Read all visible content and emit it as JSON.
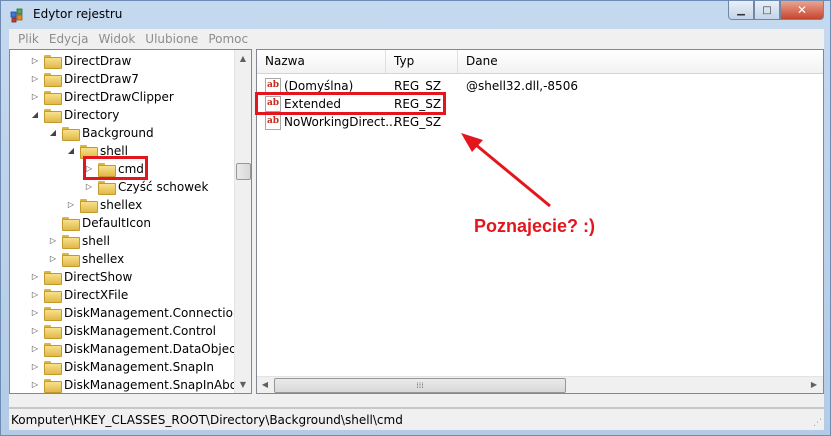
{
  "window": {
    "title": "Edytor rejestru",
    "minimize": "▁",
    "maximize": "□",
    "close": "✕"
  },
  "menu": {
    "items": [
      "Plik",
      "Edycja",
      "Widok",
      "Ulubione",
      "Pomoc"
    ]
  },
  "tree": {
    "items": [
      {
        "label": "DirectDraw",
        "depth": 1,
        "expander": "▷"
      },
      {
        "label": "DirectDraw7",
        "depth": 1,
        "expander": "▷"
      },
      {
        "label": "DirectDrawClipper",
        "depth": 1,
        "expander": "▷"
      },
      {
        "label": "Directory",
        "depth": 1,
        "expander": "◢"
      },
      {
        "label": "Background",
        "depth": 2,
        "expander": "◢"
      },
      {
        "label": "shell",
        "depth": 3,
        "expander": "◢"
      },
      {
        "label": "cmd",
        "depth": 4,
        "expander": "▷",
        "selected": true
      },
      {
        "label": "Czyść schowek",
        "depth": 4,
        "expander": "▷"
      },
      {
        "label": "shellex",
        "depth": 3,
        "expander": "▷"
      },
      {
        "label": "DefaultIcon",
        "depth": 2,
        "expander": ""
      },
      {
        "label": "shell",
        "depth": 2,
        "expander": "▷"
      },
      {
        "label": "shellex",
        "depth": 2,
        "expander": "▷"
      },
      {
        "label": "DirectShow",
        "depth": 1,
        "expander": "▷"
      },
      {
        "label": "DirectXFile",
        "depth": 1,
        "expander": "▷"
      },
      {
        "label": "DiskManagement.Connection",
        "depth": 1,
        "expander": "▷"
      },
      {
        "label": "DiskManagement.Control",
        "depth": 1,
        "expander": "▷"
      },
      {
        "label": "DiskManagement.DataObject",
        "depth": 1,
        "expander": "▷"
      },
      {
        "label": "DiskManagement.SnapIn",
        "depth": 1,
        "expander": "▷"
      },
      {
        "label": "DiskManagement.SnapInAbout",
        "depth": 1,
        "expander": "▷"
      }
    ]
  },
  "list": {
    "columns": [
      "Nazwa",
      "Typ",
      "Dane"
    ],
    "rows": [
      {
        "name": "(Domyślna)",
        "type": "REG_SZ",
        "data": "@shell32.dll,-8506",
        "icon": "ab"
      },
      {
        "name": "Extended",
        "type": "REG_SZ",
        "data": "",
        "icon": "ab"
      },
      {
        "name": "NoWorkingDirect...",
        "type": "REG_SZ",
        "data": "",
        "icon": "ab"
      }
    ]
  },
  "scroll": {
    "up": "▲",
    "down": "▼",
    "left": "◀",
    "right": "▶",
    "grip": "⁞⁞⁞"
  },
  "status": {
    "path": "Komputer\\HKEY_CLASSES_ROOT\\Directory\\Background\\shell\\cmd"
  },
  "annotation": {
    "text": "Poznajecie? :)",
    "color": "#e3161d"
  }
}
